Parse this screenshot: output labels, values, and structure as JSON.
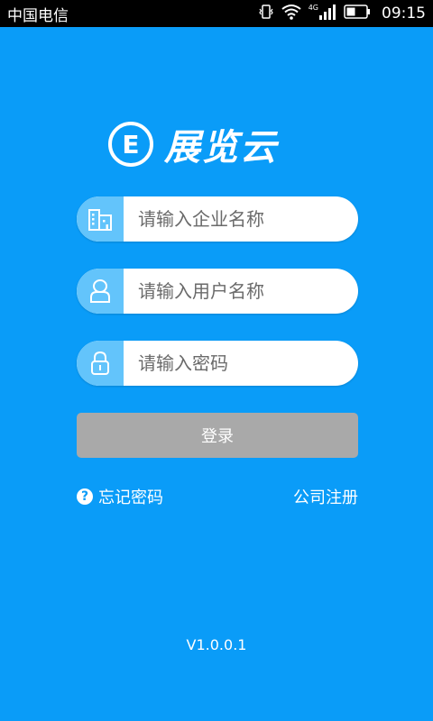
{
  "status_bar": {
    "carrier": "中国电信",
    "network": "4G",
    "time": "09:15"
  },
  "logo": {
    "mark": "E",
    "name": "展览云"
  },
  "form": {
    "company_placeholder": "请输入企业名称",
    "username_placeholder": "请输入用户名称",
    "password_placeholder": "请输入密码",
    "login_label": "登录"
  },
  "links": {
    "forgot_password": "忘记密码",
    "company_register": "公司注册"
  },
  "version": "V1.0.0.1",
  "colors": {
    "background": "#0a9cf8",
    "icon_box": "#63c4fb",
    "login_button": "#a9a9a9"
  },
  "icons": {
    "company": "building-icon",
    "user": "user-icon",
    "password": "lock-icon",
    "help": "question-icon"
  }
}
